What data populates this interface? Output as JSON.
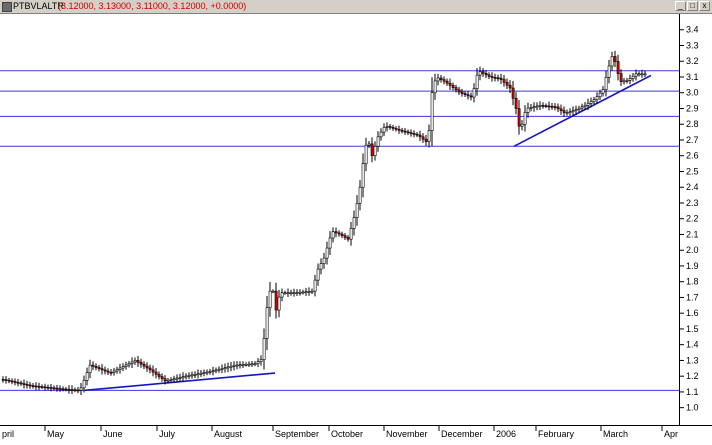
{
  "window": {
    "symbol": "PTBVLALTR",
    "ohlc_readout": "(3.12000, 3.13000, 3.11000, 3.12000, +0.0000)",
    "close_glyph": "x",
    "max_glyph": "□",
    "min_glyph": "_"
  },
  "colors": {
    "background": "#ffffff",
    "up_candle": "#ffffff",
    "down_candle": "#e00000",
    "wick": "#000000",
    "horizontal_lines": "#3a3ae0",
    "trend_lines": "#1515c0"
  },
  "chart_data": {
    "type": "candlestick",
    "y_ticks": [
      1.0,
      1.1,
      1.2,
      1.3,
      1.4,
      1.5,
      1.6,
      1.7,
      1.8,
      1.9,
      2.0,
      2.1,
      2.2,
      2.3,
      2.4,
      2.5,
      2.6,
      2.7,
      2.8,
      2.9,
      3.0,
      3.1,
      3.2,
      3.3,
      3.4
    ],
    "ylim": [
      0.89,
      3.5
    ],
    "x_labels": [
      "pril",
      "May",
      "June",
      "July",
      "August",
      "September",
      "October",
      "November",
      "December",
      "2006",
      "February",
      "March",
      "Apr"
    ],
    "horizontal_levels": [
      1.11,
      2.66,
      2.85,
      3.01,
      3.14
    ],
    "trend_lines": [
      {
        "from": [
          "May",
          1.11
        ],
        "to": [
          "August",
          1.22
        ]
      },
      {
        "from": [
          "2006",
          2.66
        ],
        "to": [
          "March",
          3.11
        ]
      }
    ],
    "grid": false,
    "legend": "none"
  }
}
